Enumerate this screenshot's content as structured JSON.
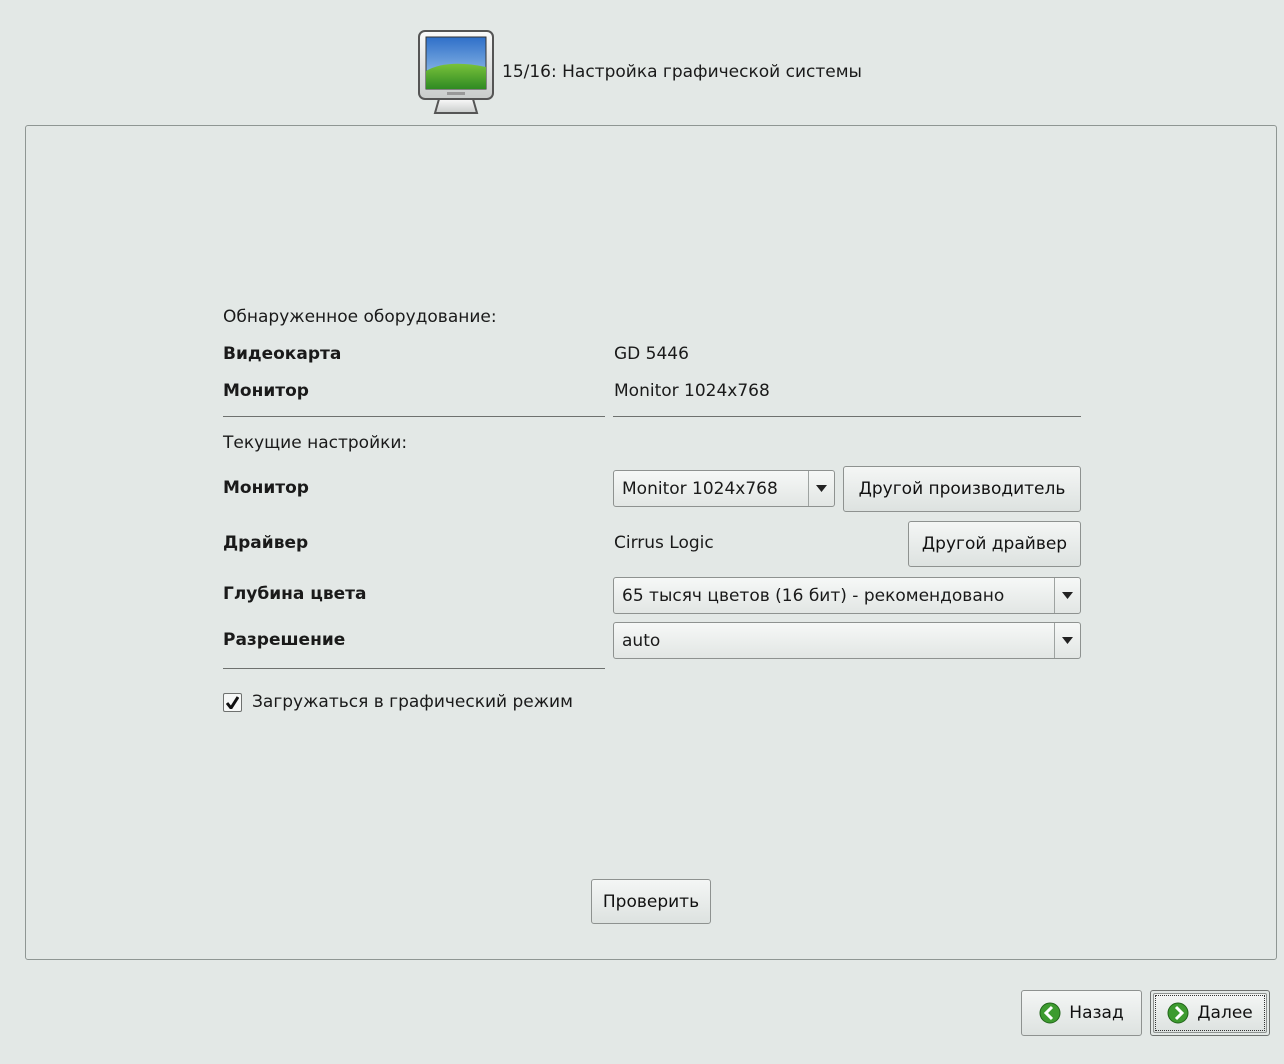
{
  "header": {
    "step_title": "15/16: Настройка графической системы",
    "icon": "monitor-icon"
  },
  "detected": {
    "section_label": "Обнаруженное оборудование:",
    "videocard_label": "Видеокарта",
    "videocard_value": "GD 5446",
    "monitor_label": "Монитор",
    "monitor_value": "Monitor 1024x768"
  },
  "current": {
    "section_label": "Текущие настройки:",
    "monitor_label": "Монитор",
    "monitor_select_value": "Monitor 1024x768",
    "other_vendor_button": "Другой производитель",
    "driver_label": "Драйвер",
    "driver_value": "Cirrus Logic",
    "other_driver_button": "Другой драйвер",
    "color_depth_label": "Глубина цвета",
    "color_depth_value": "65 тысяч цветов (16 бит) - рекомендовано",
    "resolution_label": "Разрешение",
    "resolution_value": "auto"
  },
  "boot_graphical": {
    "label": "Загружаться в графический режим",
    "checked": true
  },
  "test_button": "Проверить",
  "nav": {
    "back_label": "Назад",
    "next_label": "Далее",
    "back_icon": "arrow-left-circle-icon",
    "next_icon": "arrow-right-circle-icon"
  },
  "colors": {
    "background": "#e3e8e6",
    "nav_icon_green": "#3d9b2f"
  }
}
